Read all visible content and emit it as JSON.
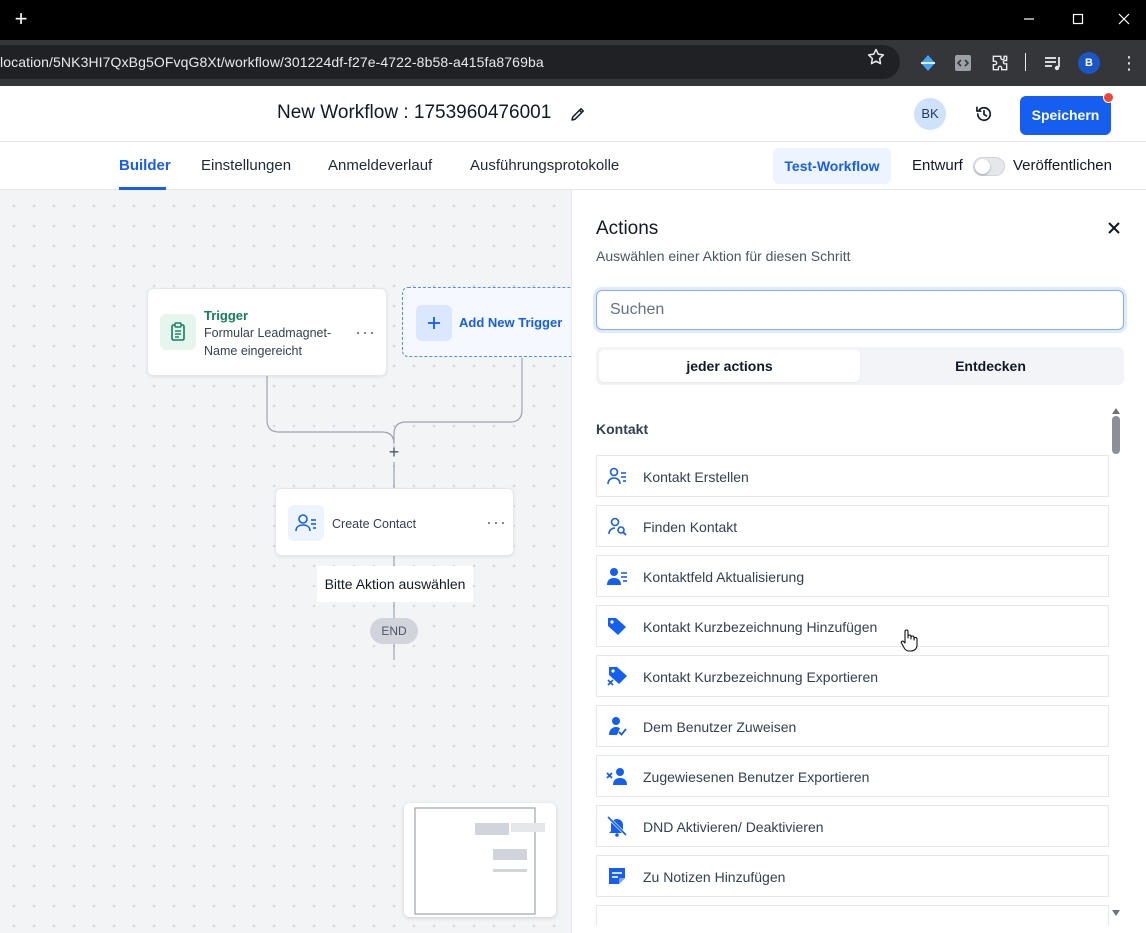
{
  "browser": {
    "url": "location/5NK3HI7QxBg5OFvqG8Xt/workflow/301224df-f27e-4722-8b58-a415fa8769ba",
    "profile_initial": "B"
  },
  "header": {
    "title": "New Workflow : 1753960476001",
    "avatar_initials": "BK",
    "save_label": "Speichern"
  },
  "tabs": [
    {
      "label": "Builder",
      "active": true
    },
    {
      "label": "Einstellungen",
      "active": false
    },
    {
      "label": "Anmeldeverlauf",
      "active": false
    },
    {
      "label": "Ausführungsprotokolle",
      "active": false
    }
  ],
  "toolbar": {
    "test_label": "Test-Workflow",
    "draft_label": "Entwurf",
    "publish_label": "Veröffentlichen",
    "published": false
  },
  "canvas": {
    "trigger": {
      "title": "Trigger",
      "line1": "Formular Leadmagnet-",
      "line2": "Name eingereicht"
    },
    "add_trigger_label": "Add New Trigger",
    "action_node_label": "Create Contact",
    "hint": "Bitte Aktion auswählen",
    "end_label": "END"
  },
  "panel": {
    "title": "Actions",
    "subtitle": "Auswählen einer Aktion für diesen Schritt",
    "search_placeholder": "Suchen",
    "segments": [
      "jeder actions",
      "Entdecken"
    ],
    "section": "Kontakt",
    "actions": [
      {
        "label": "Kontakt Erstellen",
        "icon": "user-lines-icon"
      },
      {
        "label": "Finden Kontakt",
        "icon": "user-search-icon"
      },
      {
        "label": "Kontaktfeld Aktualisierung",
        "icon": "user-fill-lines-icon"
      },
      {
        "label": "Kontakt Kurzbezeichnung Hinzufügen",
        "icon": "tag-icon"
      },
      {
        "label": "Kontakt Kurzbezeichnung Exportieren",
        "icon": "tag-x-icon"
      },
      {
        "label": "Dem Benutzer Zuweisen",
        "icon": "user-check-icon"
      },
      {
        "label": "Zugewiesenen Benutzer Exportieren",
        "icon": "user-x-icon"
      },
      {
        "label": "DND Aktivieren/ Deaktivieren",
        "icon": "bell-off-icon"
      },
      {
        "label": "Zu Notizen Hinzufügen",
        "icon": "note-icon"
      }
    ]
  },
  "colors": {
    "primary": "#155eef",
    "trigger_green": "#12805c",
    "badge_red": "#f04438"
  }
}
